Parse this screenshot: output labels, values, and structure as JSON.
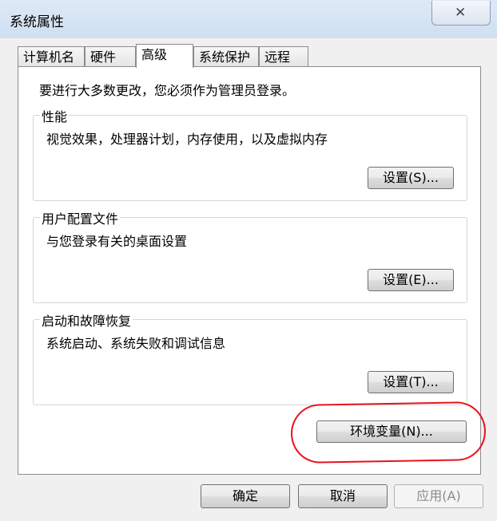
{
  "window": {
    "title": "系统属性",
    "close_symbol": "✕"
  },
  "tabs": [
    {
      "label": "计算机名"
    },
    {
      "label": "硬件"
    },
    {
      "label": "高级",
      "active": true
    },
    {
      "label": "系统保护"
    },
    {
      "label": "远程"
    }
  ],
  "intro_text": "要进行大多数更改，您必须作为管理员登录。",
  "groups": {
    "performance": {
      "title": "性能",
      "description": "视觉效果，处理器计划，内存使用，以及虚拟内存",
      "button": "设置(S)..."
    },
    "user_profiles": {
      "title": "用户配置文件",
      "description": "与您登录有关的桌面设置",
      "button": "设置(E)..."
    },
    "startup_recovery": {
      "title": "启动和故障恢复",
      "description": "系统启动、系统失败和调试信息",
      "button": "设置(T)..."
    }
  },
  "env_button": "环境变量(N)...",
  "footer": {
    "ok": "确定",
    "cancel": "取消",
    "apply": "应用(A)"
  },
  "colors": {
    "annotation": "#e8121c",
    "titlebar": "#d6e5f5",
    "dialog_bg": "#f0f0f0"
  }
}
